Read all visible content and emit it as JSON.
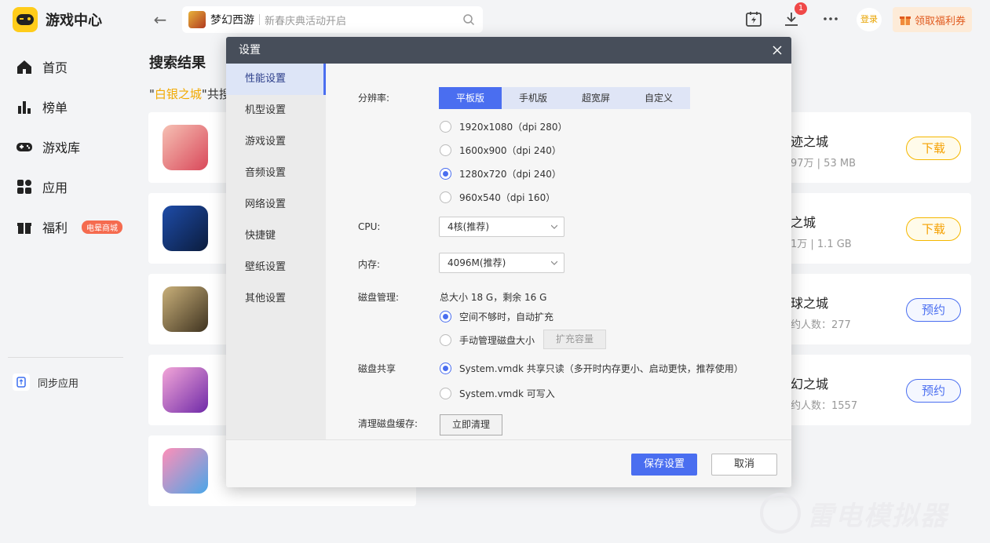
{
  "app": {
    "title": "游戏中心"
  },
  "search": {
    "game_name": "梦幻西游",
    "placeholder": "新春庆典活动开启"
  },
  "header": {
    "download_badge": "1",
    "login_label": "登录",
    "coupon_label": "领取福利券"
  },
  "sidebar": {
    "items": [
      {
        "label": "首页"
      },
      {
        "label": "榜单"
      },
      {
        "label": "游戏库"
      },
      {
        "label": "应用"
      },
      {
        "label": "福利",
        "badge": "电晕商城"
      }
    ],
    "sync_label": "同步应用"
  },
  "results": {
    "title": "搜索结果",
    "sub_prefix": "\"",
    "keyword": "白银之城",
    "sub_suffix": "\"共搜"
  },
  "cards": [
    {
      "name": "迹之城",
      "meta": "97万 | 53 MB",
      "button": "下载",
      "type": "download"
    },
    {
      "name": "之城",
      "meta": "1万 | 1.1 GB",
      "button": "下载",
      "type": "download"
    },
    {
      "name": "球之城",
      "meta": "约人数：277",
      "button": "预约",
      "type": "book"
    },
    {
      "name": "幻之城",
      "meta": "约人数：1557",
      "button": "预约",
      "type": "book"
    }
  ],
  "modal": {
    "title": "设置",
    "nav": [
      "性能设置",
      "机型设置",
      "游戏设置",
      "音频设置",
      "网络设置",
      "快捷键",
      "壁纸设置",
      "其他设置"
    ],
    "resolution_label": "分辨率:",
    "tabs": [
      "平板版",
      "手机版",
      "超宽屏",
      "自定义"
    ],
    "resolutions": [
      "1920x1080（dpi 280）",
      "1600x900（dpi 240）",
      "1280x720（dpi 240）",
      "960x540（dpi 160）"
    ],
    "selected_resolution": 2,
    "cpu_label": "CPU:",
    "cpu_value": "4核(推荐)",
    "memory_label": "内存:",
    "memory_value": "4096M(推荐)",
    "disk_label": "磁盘管理:",
    "disk_info": "总大小 18 G，剩余 16 G",
    "disk_auto": "空间不够时，自动扩充",
    "disk_manual": "手动管理磁盘大小",
    "expand_label": "扩充容量",
    "share_label": "磁盘共享",
    "share_readonly": "System.vmdk 共享只读（多开时内存更小、启动更快，推荐使用）",
    "share_writable": "System.vmdk 可写入",
    "cache_label": "清理磁盘缓存:",
    "clean_label": "立即清理",
    "save_label": "保存设置",
    "cancel_label": "取消"
  },
  "watermark": {
    "text": "雷电模拟器"
  },
  "colors": {
    "accent": "#4a6ef0",
    "brand_yellow": "#ffcc1a",
    "header_dark": "#474e5a"
  }
}
